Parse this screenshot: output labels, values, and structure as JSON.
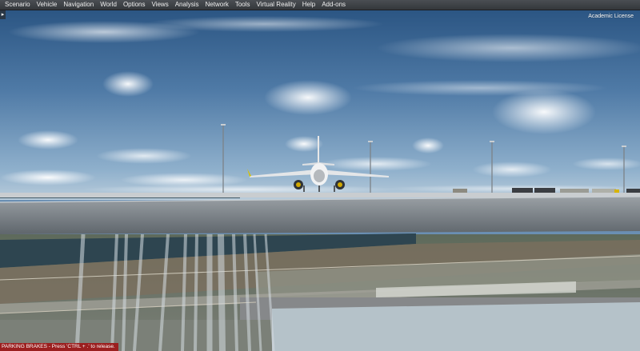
{
  "menu": {
    "items": [
      "Scenario",
      "Vehicle",
      "Navigation",
      "World",
      "Options",
      "Views",
      "Analysis",
      "Network",
      "Tools",
      "Virtual Reality",
      "Help",
      "Add-ons"
    ]
  },
  "license_text": "Academic License",
  "status_message": "PARKING BRAKES - Press 'CTRL + .' to release.",
  "colors": {
    "menubar": "#3d4145",
    "status_bar": "#9b1f1f",
    "sky": "#5a84ad",
    "water": "#2e4550"
  }
}
